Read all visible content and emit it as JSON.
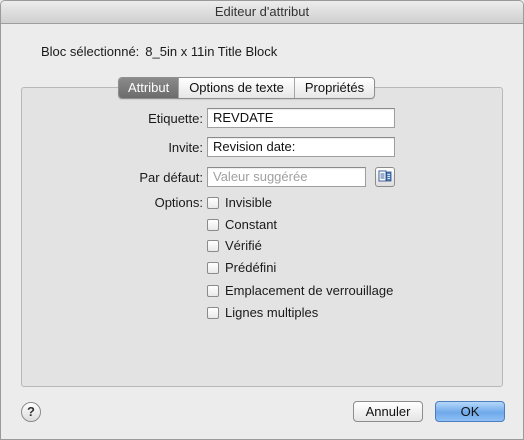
{
  "window": {
    "title": "Editeur d'attribut"
  },
  "block": {
    "label": "Bloc sélectionné:",
    "value": "8_5in x 11in Title Block"
  },
  "tabs": [
    {
      "label": "Attribut",
      "active": true
    },
    {
      "label": "Options de texte",
      "active": false
    },
    {
      "label": "Propriétés",
      "active": false
    }
  ],
  "fields": {
    "tag": {
      "label": "Etiquette:",
      "value": "REVDATE"
    },
    "prompt": {
      "label": "Invite:",
      "value": "Revision date:"
    },
    "default": {
      "label": "Par défaut:",
      "value": "",
      "placeholder": "Valeur suggérée"
    }
  },
  "options": {
    "label": "Options:",
    "items": [
      {
        "label": "Invisible",
        "checked": false
      },
      {
        "label": "Constant",
        "checked": false
      },
      {
        "label": "Vérifié",
        "checked": false
      },
      {
        "label": "Prédéfini",
        "checked": false
      },
      {
        "label": "Emplacement de verrouillage",
        "checked": false
      },
      {
        "label": "Lignes multiples",
        "checked": false
      }
    ]
  },
  "footer": {
    "help": "?",
    "cancel": "Annuler",
    "ok": "OK"
  },
  "icons": {
    "field_picker": "insert-field-icon",
    "help": "help-icon"
  },
  "colors": {
    "accent": "#6fa9ea",
    "active_tab": "#7a7a7a"
  }
}
